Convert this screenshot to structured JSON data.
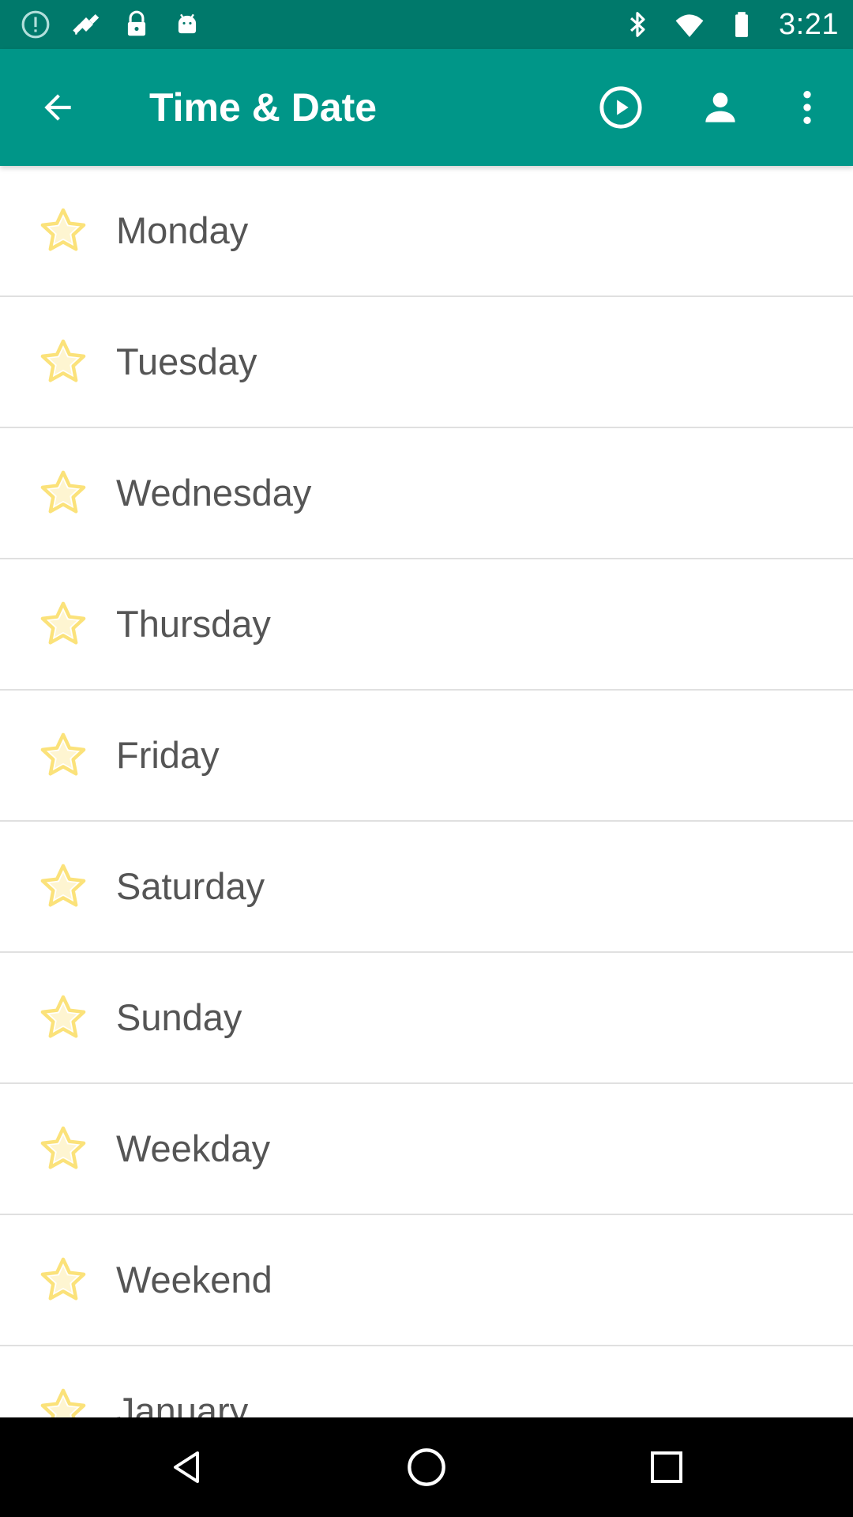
{
  "status_bar": {
    "time": "3:21",
    "left_icons": [
      "alert-circle-icon",
      "fake-gps-icon",
      "lock-icon",
      "android-icon"
    ],
    "right_icons": [
      "bluetooth-icon",
      "wifi-icon",
      "battery-icon"
    ]
  },
  "app_bar": {
    "title": "Time & Date",
    "background": "#009688",
    "status_background": "#00796b",
    "actions": [
      "play-icon",
      "person-icon",
      "more-vert-icon"
    ]
  },
  "list": {
    "star_color": "#fbe27a",
    "items": [
      {
        "label": "Monday"
      },
      {
        "label": "Tuesday"
      },
      {
        "label": "Wednesday"
      },
      {
        "label": "Thursday"
      },
      {
        "label": "Friday"
      },
      {
        "label": "Saturday"
      },
      {
        "label": "Sunday"
      },
      {
        "label": "Weekday"
      },
      {
        "label": "Weekend"
      },
      {
        "label": "January"
      }
    ]
  },
  "nav_bar": {
    "buttons": [
      "nav-back-icon",
      "nav-home-icon",
      "nav-recents-icon"
    ]
  }
}
